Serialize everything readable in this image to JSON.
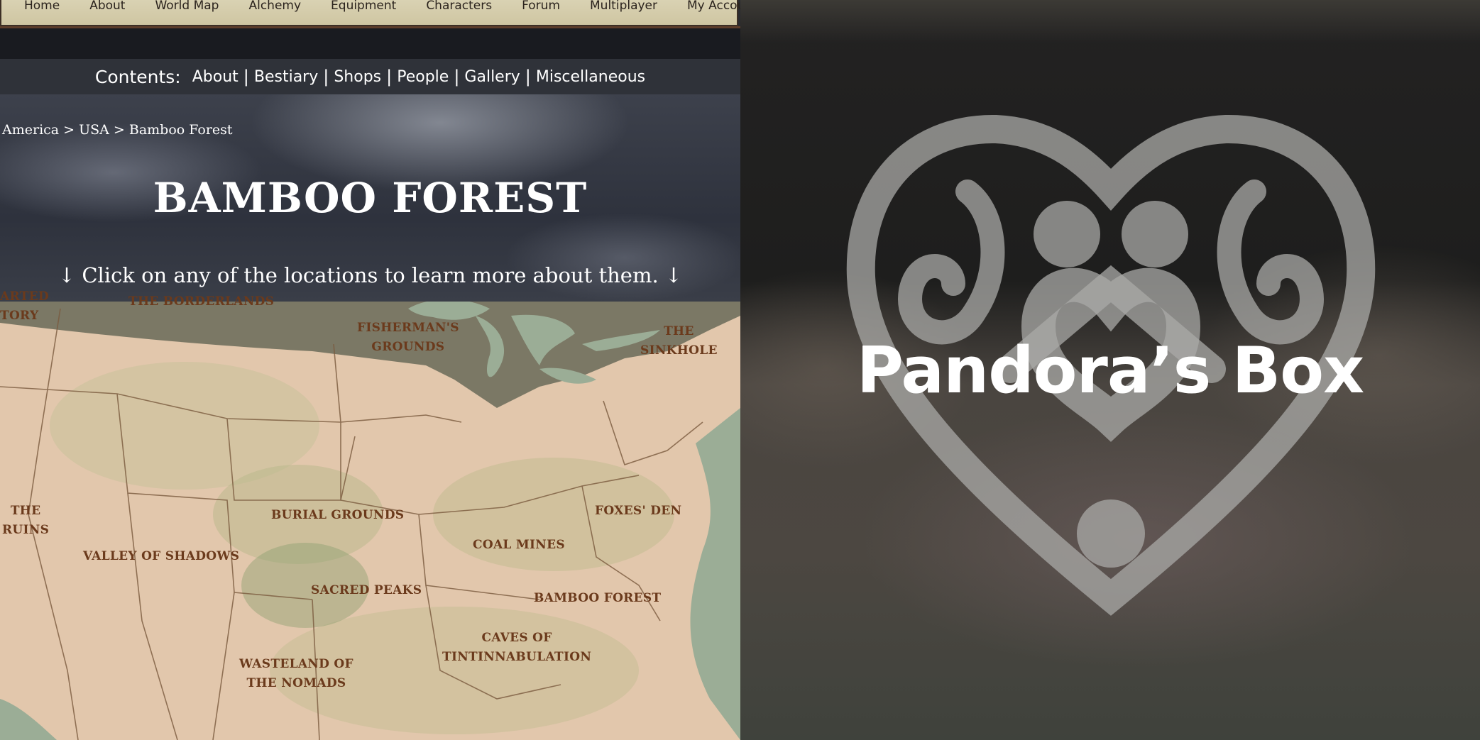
{
  "nav": {
    "items": [
      "Home",
      "About",
      "World Map",
      "Alchemy",
      "Equipment",
      "Characters",
      "Forum",
      "Multiplayer",
      "My Account"
    ]
  },
  "contents": {
    "label": "Contents:",
    "links": [
      "About",
      "Bestiary",
      "Shops",
      "People",
      "Gallery",
      "Miscellaneous"
    ]
  },
  "breadcrumb": "America > USA > Bamboo Forest",
  "page_title": "BAMBOO FOREST",
  "instruction": "↓ Click on any of the locations to learn more about them. ↓",
  "map": {
    "regions": [
      {
        "line1": "ARTED",
        "line2": "TORY"
      },
      {
        "line1": "THE BORDERLANDS",
        "line2": ""
      },
      {
        "line1": "FISHERMAN'S",
        "line2": "GROUNDS"
      },
      {
        "line1": "THE",
        "line2": "SINKHOLE"
      },
      {
        "line1": "THE",
        "line2": "RUINS"
      },
      {
        "line1": "BURIAL GROUNDS",
        "line2": ""
      },
      {
        "line1": "FOXES' DEN",
        "line2": ""
      },
      {
        "line1": "COAL MINES",
        "line2": ""
      },
      {
        "line1": "VALLEY OF SHADOWS",
        "line2": ""
      },
      {
        "line1": "SACRED PEAKS",
        "line2": ""
      },
      {
        "line1": "BAMBOO FOREST",
        "line2": ""
      },
      {
        "line1": "CAVES OF",
        "line2": "TINTINNABULATION"
      },
      {
        "line1": "WASTELAND OF",
        "line2": "THE NOMADS"
      }
    ]
  },
  "brand": {
    "title": "Pandora’s Box",
    "icon": "heart-swirl-logo"
  },
  "colors": {
    "nav_bg": "#d6cfae",
    "map_text": "#6b3a1c",
    "land": "#e2c7ac",
    "water": "#9bad96"
  }
}
